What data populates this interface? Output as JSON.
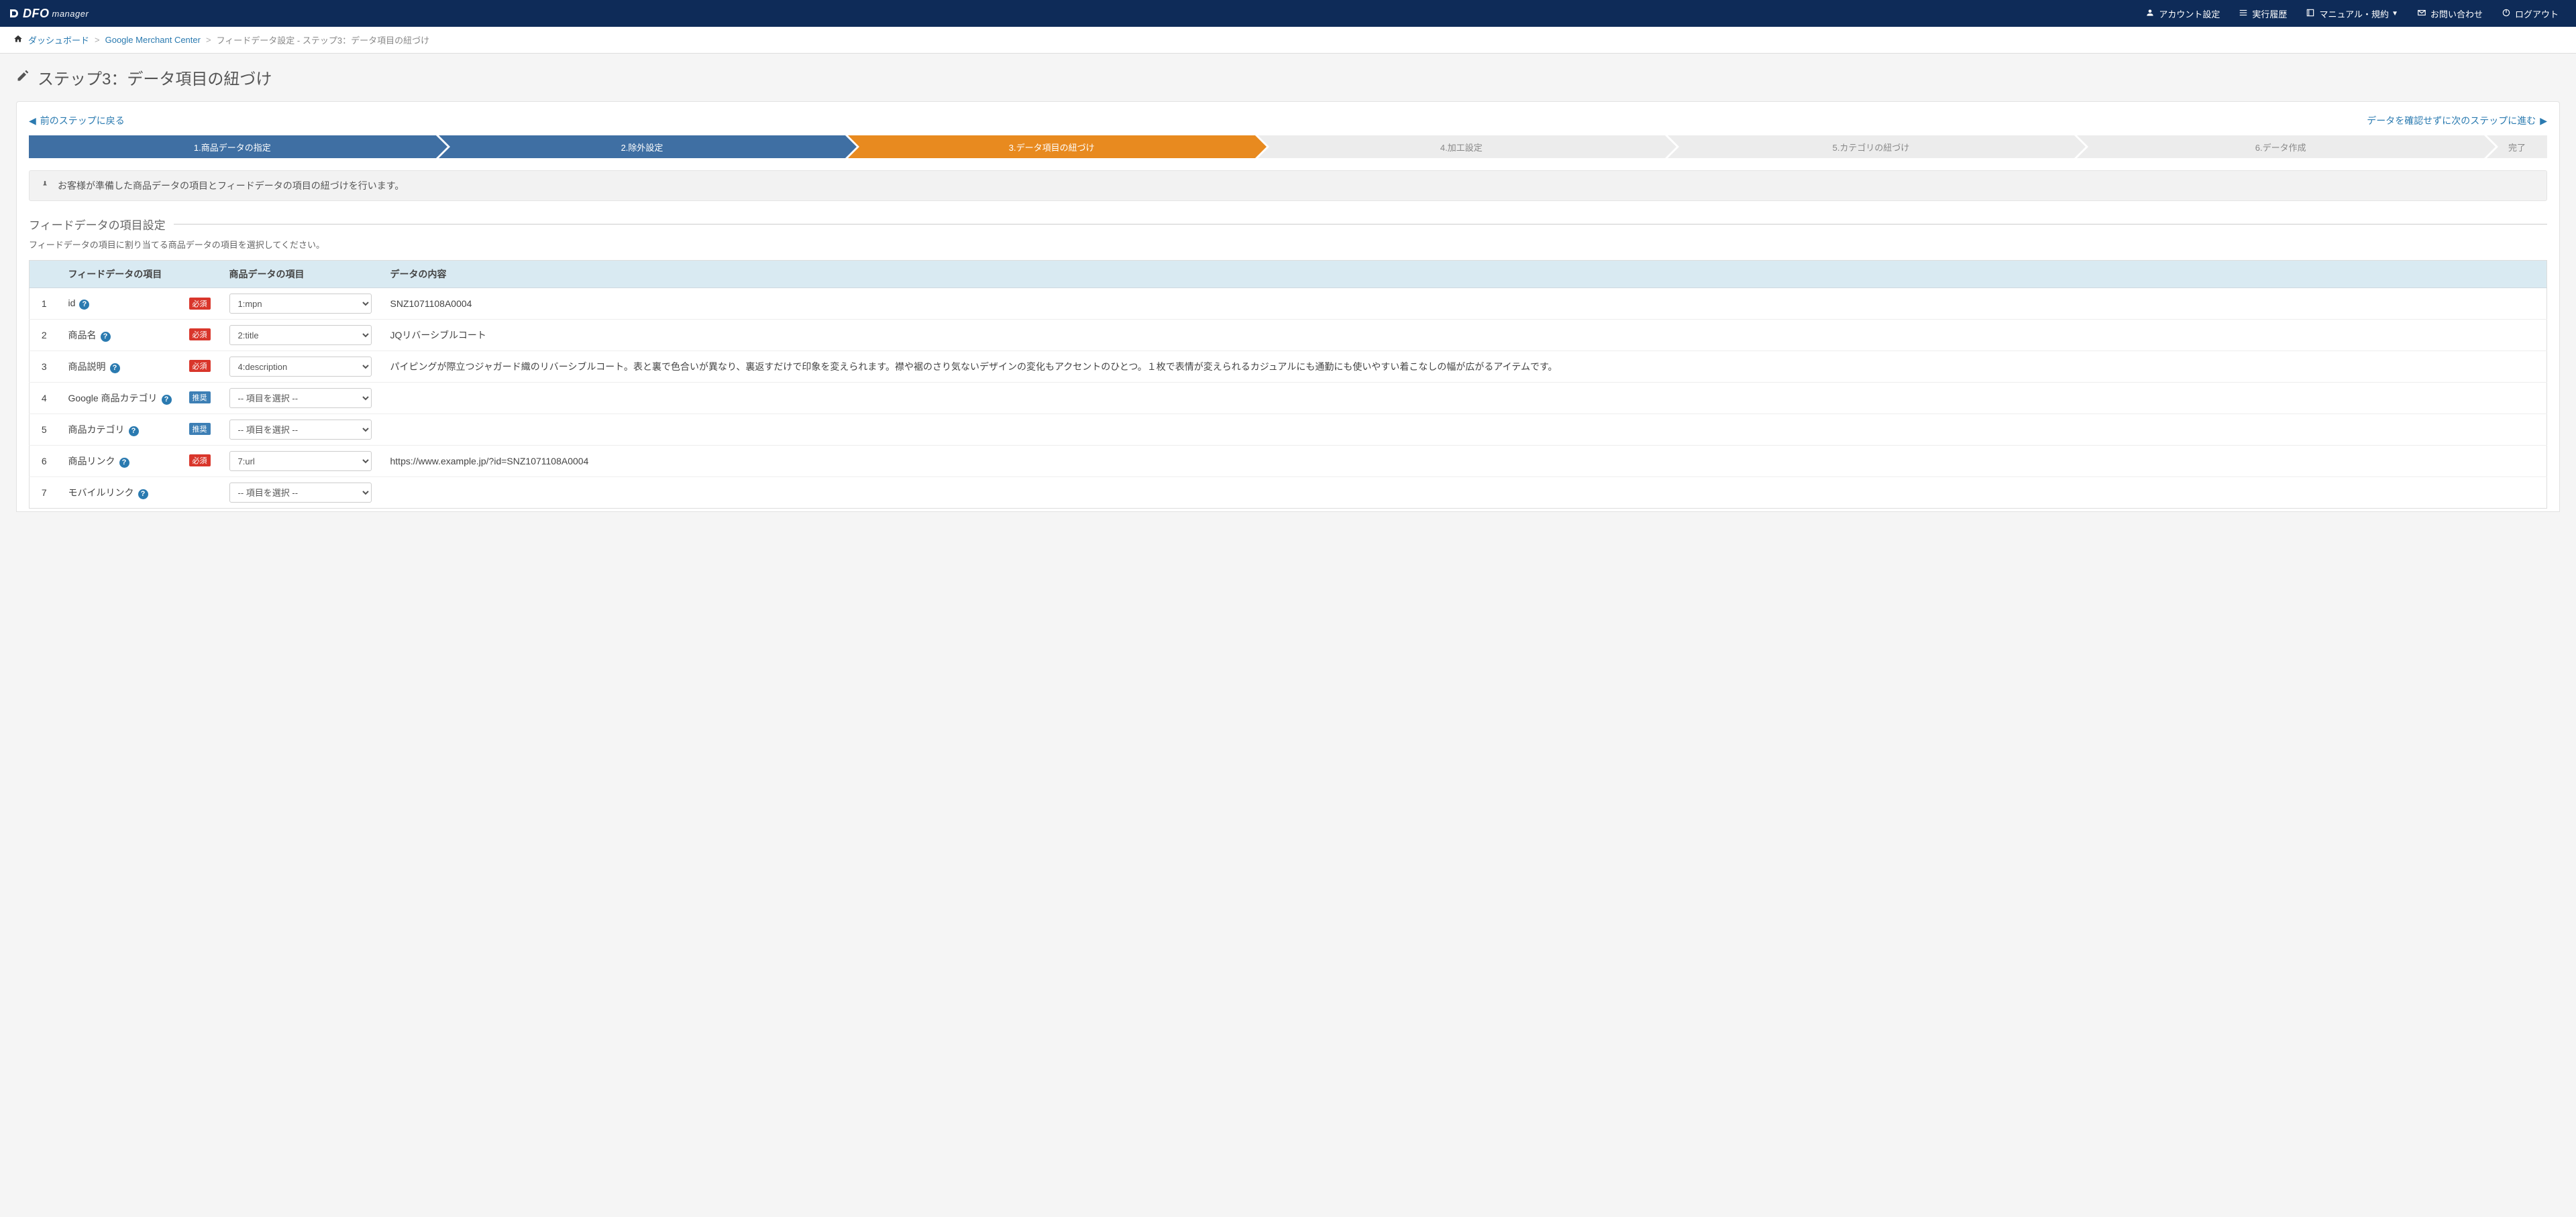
{
  "brand": {
    "main": "DFO",
    "sub": "manager"
  },
  "nav": {
    "account": "アカウント設定",
    "history": "実行履歴",
    "manual": "マニュアル・規約",
    "contact": "お問い合わせ",
    "logout": "ログアウト"
  },
  "breadcrumb": {
    "home": "ダッシュボード",
    "mid": "Google Merchant Center",
    "current": "フィードデータ設定 - ステップ3：データ項目の紐づけ"
  },
  "page_title": "ステップ3：データ項目の紐づけ",
  "links": {
    "prev": "前のステップに戻る",
    "next": "データを確認せずに次のステップに進む"
  },
  "wizard": {
    "s1": "1.商品データの指定",
    "s2": "2.除外設定",
    "s3": "3.データ項目の紐づけ",
    "s4": "4.加工設定",
    "s5": "5.カテゴリの紐づけ",
    "s6": "6.データ作成",
    "finish": "完了"
  },
  "info_text": "お客様が準備した商品データの項目とフィードデータの項目の紐づけを行います。",
  "section": {
    "title": "フィードデータの項目設定",
    "sub": "フィードデータの項目に割り当てる商品データの項目を選択してください。"
  },
  "table": {
    "head": {
      "feed": "フィードデータの項目",
      "prod": "商品データの項目",
      "data": "データの内容"
    },
    "badges": {
      "req": "必須",
      "rec": "推奨"
    },
    "placeholder": "-- 項目を選択 --",
    "rows": [
      {
        "num": "1",
        "feed": "id",
        "badge": "req",
        "prod": "1:mpn",
        "data": "SNZ1071108A0004"
      },
      {
        "num": "2",
        "feed": "商品名",
        "badge": "req",
        "prod": "2:title",
        "data": "JQリバーシブルコート"
      },
      {
        "num": "3",
        "feed": "商品説明",
        "badge": "req",
        "prod": "4:description",
        "data": "パイピングが際立つジャガード織のリバーシブルコート。表と裏で色合いが異なり、裏返すだけで印象を変えられます。襟や裾のさり気ないデザインの変化もアクセントのひとつ。１枚で表情が変えられるカジュアルにも通勤にも使いやすい着こなしの幅が広がるアイテムです。"
      },
      {
        "num": "4",
        "feed": "Google 商品カテゴリ",
        "badge": "rec",
        "prod": "",
        "data": ""
      },
      {
        "num": "5",
        "feed": "商品カテゴリ",
        "badge": "rec",
        "prod": "",
        "data": ""
      },
      {
        "num": "6",
        "feed": "商品リンク",
        "badge": "req",
        "prod": "7:url",
        "data": "https://www.example.jp/?id=SNZ1071108A0004"
      },
      {
        "num": "7",
        "feed": "モバイルリンク",
        "badge": "",
        "prod": "",
        "data": ""
      }
    ]
  }
}
